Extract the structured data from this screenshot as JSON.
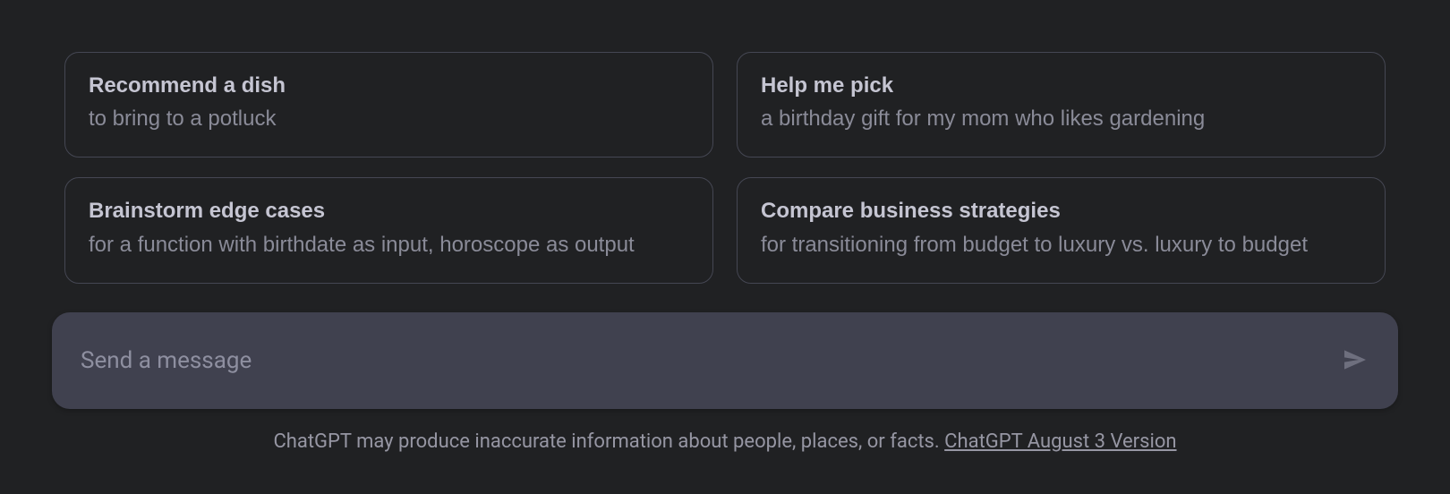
{
  "suggestions": [
    {
      "title": "Recommend a dish",
      "subtitle": "to bring to a potluck"
    },
    {
      "title": "Help me pick",
      "subtitle": "a birthday gift for my mom who likes gardening"
    },
    {
      "title": "Brainstorm edge cases",
      "subtitle": "for a function with birthdate as input, horoscope as output"
    },
    {
      "title": "Compare business strategies",
      "subtitle": "for transitioning from budget to luxury vs. luxury to budget"
    }
  ],
  "input": {
    "placeholder": "Send a message",
    "value": ""
  },
  "footer": {
    "disclaimer_prefix": "ChatGPT may produce inaccurate information about people, places, or facts. ",
    "version_link": "ChatGPT August 3 Version"
  }
}
